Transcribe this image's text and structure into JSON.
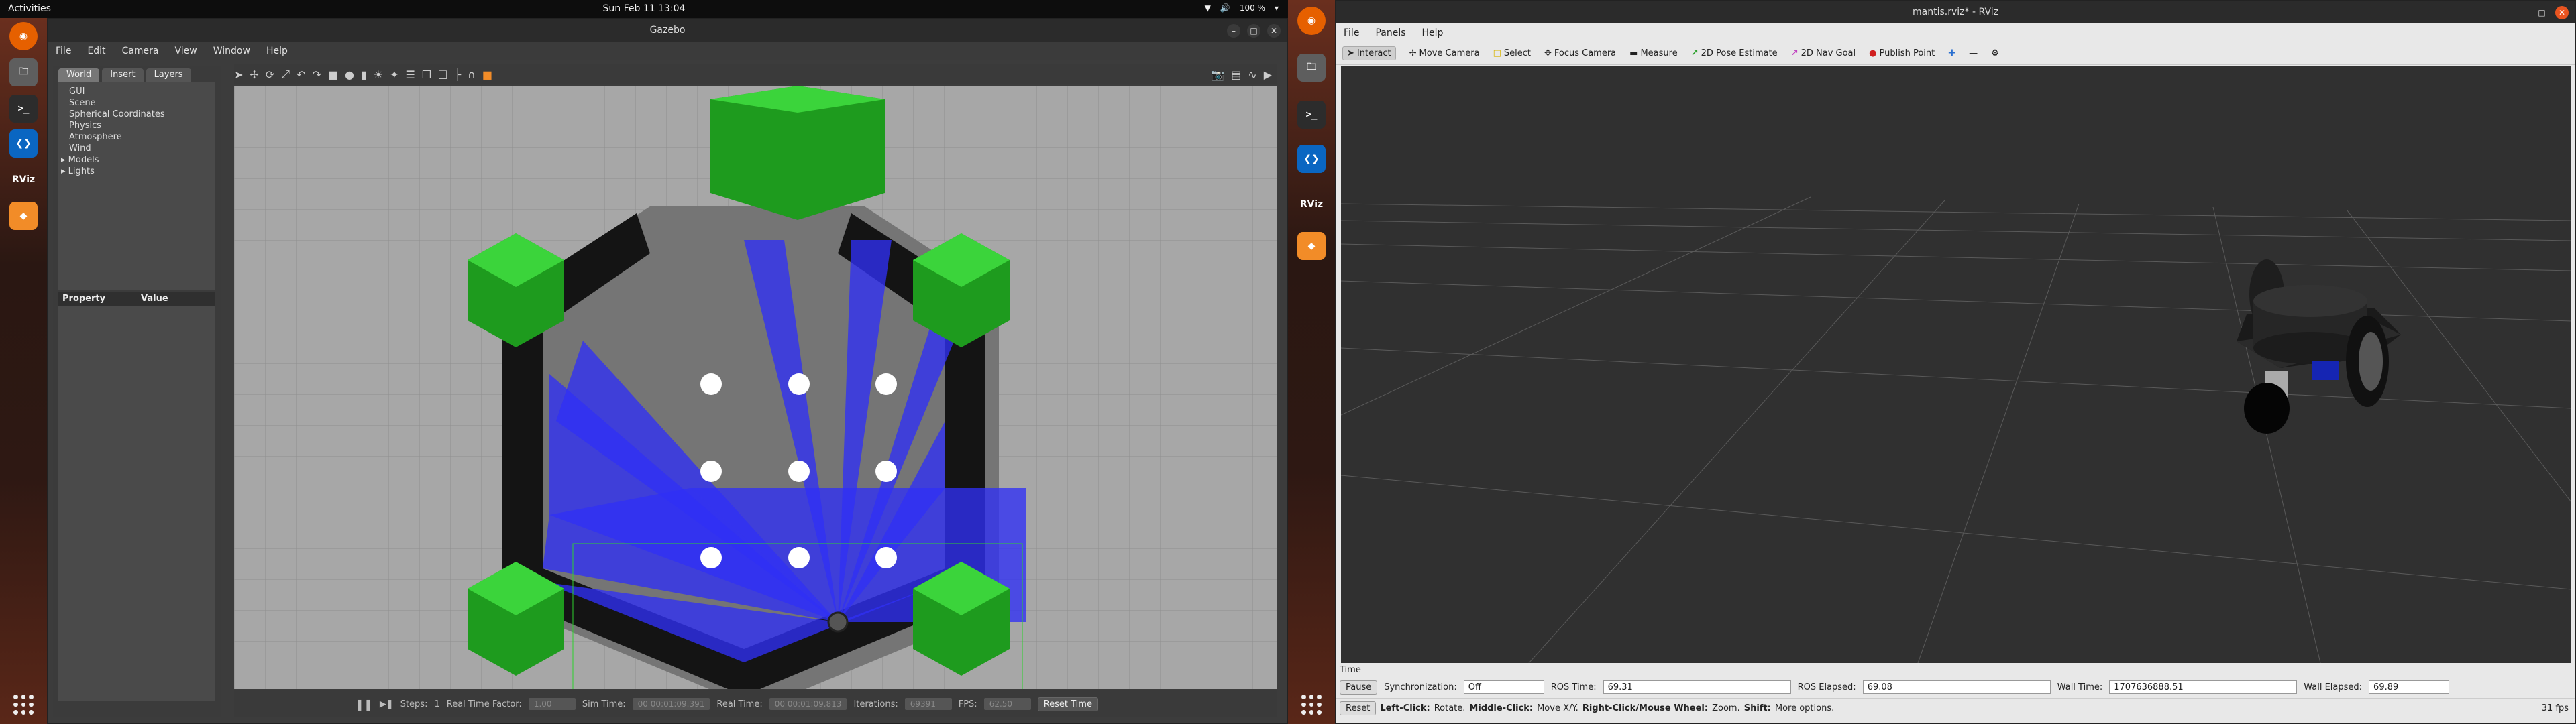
{
  "system": {
    "activities": "Activities",
    "clock": "Sun Feb 11  13:04",
    "battery": "100 %"
  },
  "gazebo": {
    "title": "Gazebo",
    "menu": [
      "File",
      "Edit",
      "Camera",
      "View",
      "Window",
      "Help"
    ],
    "tabs": [
      "World",
      "Insert",
      "Layers"
    ],
    "tree": [
      "GUI",
      "Scene",
      "Spherical Coordinates",
      "Physics",
      "Atmosphere",
      "Wind",
      "Models",
      "Lights"
    ],
    "props_header": [
      "Property",
      "Value"
    ],
    "status": {
      "steps_label": "Steps:",
      "steps_value": "1",
      "rtf_label": "Real Time Factor:",
      "rtf_value": "1.00",
      "sim_time_label": "Sim Time:",
      "sim_time_value": "00 00:01:09.391",
      "real_time_label": "Real Time:",
      "real_time_value": "00 00:01:09.813",
      "iterations_label": "Iterations:",
      "iterations_value": "69391",
      "fps_label": "FPS:",
      "fps_value": "62.50",
      "reset_time": "Reset Time"
    }
  },
  "rviz": {
    "title": "mantis.rviz* - RViz",
    "menu": [
      "File",
      "Panels",
      "Help"
    ],
    "tools": [
      "Interact",
      "Move Camera",
      "Select",
      "Focus Camera",
      "Measure",
      "2D Pose Estimate",
      "2D Nav Goal",
      "Publish Point"
    ],
    "time_panel": {
      "title": "Time",
      "pause": "Pause",
      "sync_label": "Synchronization:",
      "sync_value": "Off",
      "ros_time_label": "ROS Time:",
      "ros_time_value": "69.31",
      "ros_elapsed_label": "ROS Elapsed:",
      "ros_elapsed_value": "69.08",
      "wall_time_label": "Wall Time:",
      "wall_time_value": "1707636888.51",
      "wall_elapsed_label": "Wall Elapsed:",
      "wall_elapsed_value": "69.89"
    },
    "footer": {
      "reset": "Reset",
      "hint_lc": "Left-Click:",
      "hint_lc_text": "Rotate.",
      "hint_mc": "Middle-Click:",
      "hint_mc_text": "Move X/Y.",
      "hint_rc": "Right-Click/Mouse Wheel:",
      "hint_rc_text": "Zoom.",
      "hint_shift": "Shift:",
      "hint_shift_text": "More options.",
      "fps": "31 fps"
    }
  }
}
